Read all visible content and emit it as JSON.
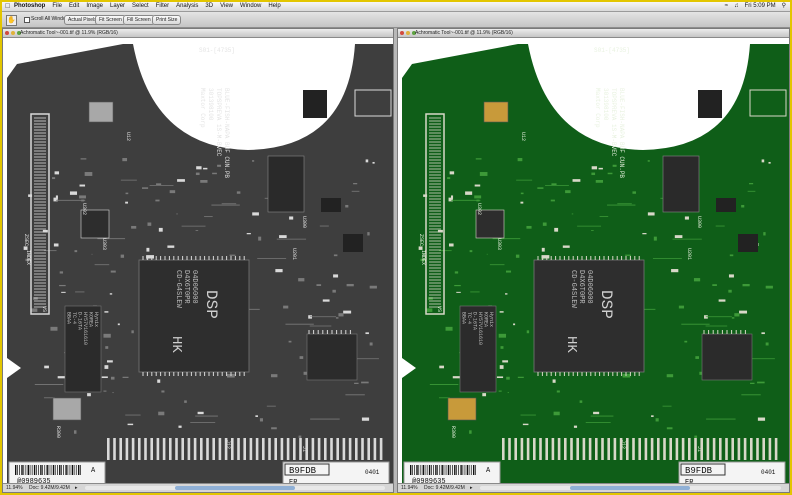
{
  "menubar": {
    "app": "Photoshop",
    "menus": [
      "File",
      "Edit",
      "Image",
      "Layer",
      "Select",
      "Filter",
      "Analysis",
      "3D",
      "View",
      "Window",
      "Help"
    ],
    "clock": "Fri 5:09 PM"
  },
  "options": {
    "scroll_all_label": "Scroll All Windows",
    "actual_pixels": "Actual Pixels",
    "fit_screen": "Fit Screen",
    "fill_screen": "Fill Screen",
    "print_size": "Print Size"
  },
  "windows": [
    {
      "title": "Achromatic Tool~-001.tif @ 11.9% (RGB/16)",
      "zoom": "11.94%",
      "doc": "Doc: 9.42M/9.42M",
      "board_color": "#3e3e3e",
      "trace_color": "#7a7a7a"
    },
    {
      "title": "Achromatic Tool~-001.tif @ 11.9% (RGB/16)",
      "zoom": "11.94%",
      "doc": "Doc: 9.42M/9.42M",
      "board_color": "#0f5e18",
      "trace_color": "#3d9a38"
    }
  ],
  "board": {
    "lines": [
      "BLUE-FISH-NAPA BUF CUN.PB",
      "TOPSPREVA 1S-M-BVEC",
      "301398100",
      "Maxtor Corp"
    ],
    "dsp_chip": [
      "DSP",
      "04D06000",
      "D4X6T0PR",
      "CD-G4SLEW"
    ],
    "dsp_brand": "HK",
    "mem_chip": [
      "Hynix",
      "KOREA",
      "HY57V161610",
      "D-16TA",
      "TC-4",
      "BBAA"
    ],
    "labels": [
      "U303",
      "U302",
      "U12",
      "U300",
      "U201",
      "INDEX",
      "ZSEC",
      "VS",
      "J1",
      "J12",
      "R300"
    ],
    "barcode_text": "@0989635",
    "barcode_code": "A",
    "part_code": "B9FDB",
    "rev_code": "ER",
    "rev_number": "0401",
    "corner_text": "S01-[4735]"
  }
}
